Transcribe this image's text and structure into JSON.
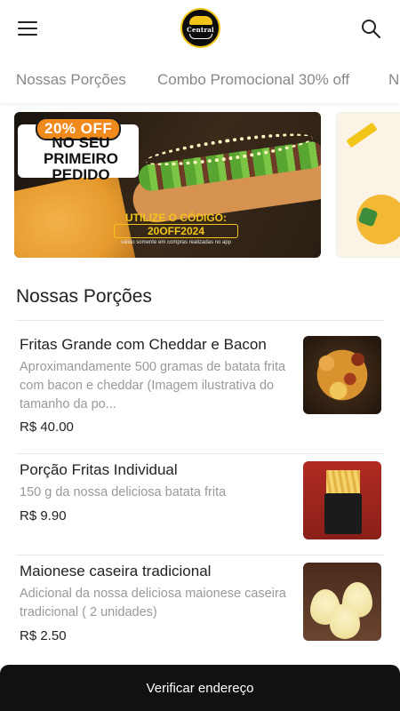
{
  "header": {
    "logo_text": "Central",
    "menu_icon": "hamburger-menu-icon",
    "search_icon": "search-icon"
  },
  "tabs": [
    {
      "label": "Nossas Porções"
    },
    {
      "label": "Combo Promocional 30% off"
    },
    {
      "label": "N"
    }
  ],
  "banner": {
    "discount": "20% OFF",
    "line1": "NO SEU",
    "line2": "PRIMEIRO",
    "line3": "PEDIDO",
    "code_label": "UTILIZE O CÓDIGO:",
    "code": "20OFF2024",
    "note": "válido somente em compras realizadas no app"
  },
  "section": {
    "title": "Nossas Porções"
  },
  "items": [
    {
      "title": "Fritas Grande com Cheddar e Bacon",
      "description": "Aproximandamente 500 gramas de batata frita com bacon e cheddar (Imagem ilustrativa do tamanho da po...",
      "price": "R$ 40.00"
    },
    {
      "title": "Porção Fritas Individual",
      "description": "150 g da nossa deliciosa batata frita",
      "price": "R$ 9.90"
    },
    {
      "title": "Maionese caseira tradicional",
      "description": "Adicional da nossa deliciosa maionese caseira tradicional ( 2 unidades)",
      "price": "R$ 2.50"
    }
  ],
  "bottom_bar": {
    "label": "Verificar endereço"
  },
  "colors": {
    "accent": "#f08a1c",
    "brand_yellow": "#f3c51a",
    "bottom_bar": "#111111"
  }
}
